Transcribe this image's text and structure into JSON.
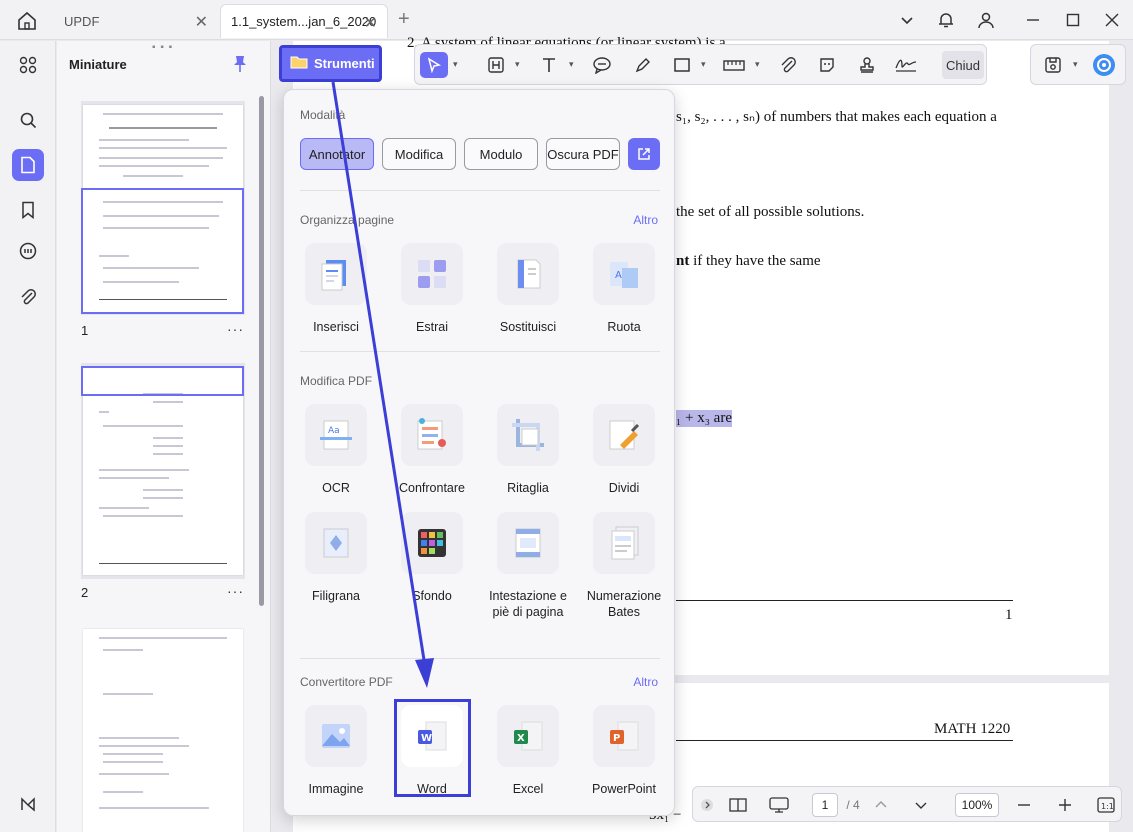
{
  "tabs": [
    {
      "label": "UPDF"
    },
    {
      "label": "1.1_system...jan_6_2020"
    }
  ],
  "thumbnails": {
    "title": "Miniature",
    "pages": [
      {
        "number": "1"
      },
      {
        "number": "2"
      }
    ],
    "more_label": "···"
  },
  "toolbar": {
    "strumenti_label": "Strumenti",
    "close_label": "Chiud"
  },
  "document": {
    "line1": "2. A system of linear equations (or linear system) is a",
    "line2": "s₁, s₂, . . . , sₙ) of numbers that makes each equation a",
    "line3": "the set of all possible solutions.",
    "line4_bold": "nt",
    "line4": " if they have the same",
    "line5": "₁ + x₃ are",
    "page_number": "1",
    "header_right": "MATH 1220",
    "bottom_fragment": "5x₁ −"
  },
  "popup": {
    "modes_title": "Modalità",
    "modes": [
      {
        "label": "Annotator",
        "active": true
      },
      {
        "label": "Modifica",
        "active": false
      },
      {
        "label": "Modulo",
        "active": false
      },
      {
        "label": "Oscura PDF",
        "active": false
      }
    ],
    "organize": {
      "title": "Organizza pagine",
      "more": "Altro",
      "items": [
        {
          "label": "Inserisci",
          "icon": "insert-pages-icon"
        },
        {
          "label": "Estrai",
          "icon": "extract-pages-icon"
        },
        {
          "label": "Sostituisci",
          "icon": "replace-pages-icon"
        },
        {
          "label": "Ruota",
          "icon": "rotate-pages-icon"
        }
      ]
    },
    "edit": {
      "title": "Modifica PDF",
      "items": [
        {
          "label": "OCR",
          "icon": "ocr-icon"
        },
        {
          "label": "Confrontare",
          "icon": "compare-icon"
        },
        {
          "label": "Ritaglia",
          "icon": "crop-icon"
        },
        {
          "label": "Dividi",
          "icon": "split-icon"
        },
        {
          "label": "Filigrana",
          "icon": "watermark-icon"
        },
        {
          "label": "Sfondo",
          "icon": "background-icon"
        },
        {
          "label": "Intestazione e piè di pagina",
          "icon": "header-footer-icon"
        },
        {
          "label": "Numerazione Bates",
          "icon": "bates-numbering-icon"
        }
      ]
    },
    "convert": {
      "title": "Convertitore PDF",
      "more": "Altro",
      "items": [
        {
          "label": "Immagine",
          "icon": "image-convert-icon"
        },
        {
          "label": "Word",
          "icon": "word-convert-icon"
        },
        {
          "label": "Excel",
          "icon": "excel-convert-icon"
        },
        {
          "label": "PowerPoint",
          "icon": "powerpoint-convert-icon"
        }
      ]
    }
  },
  "bottombar": {
    "current_page": "1",
    "total_pages": "/ 4",
    "zoom": "100%"
  },
  "colors": {
    "accent": "#6b6ef5",
    "highlight": "#3b3fd6"
  }
}
